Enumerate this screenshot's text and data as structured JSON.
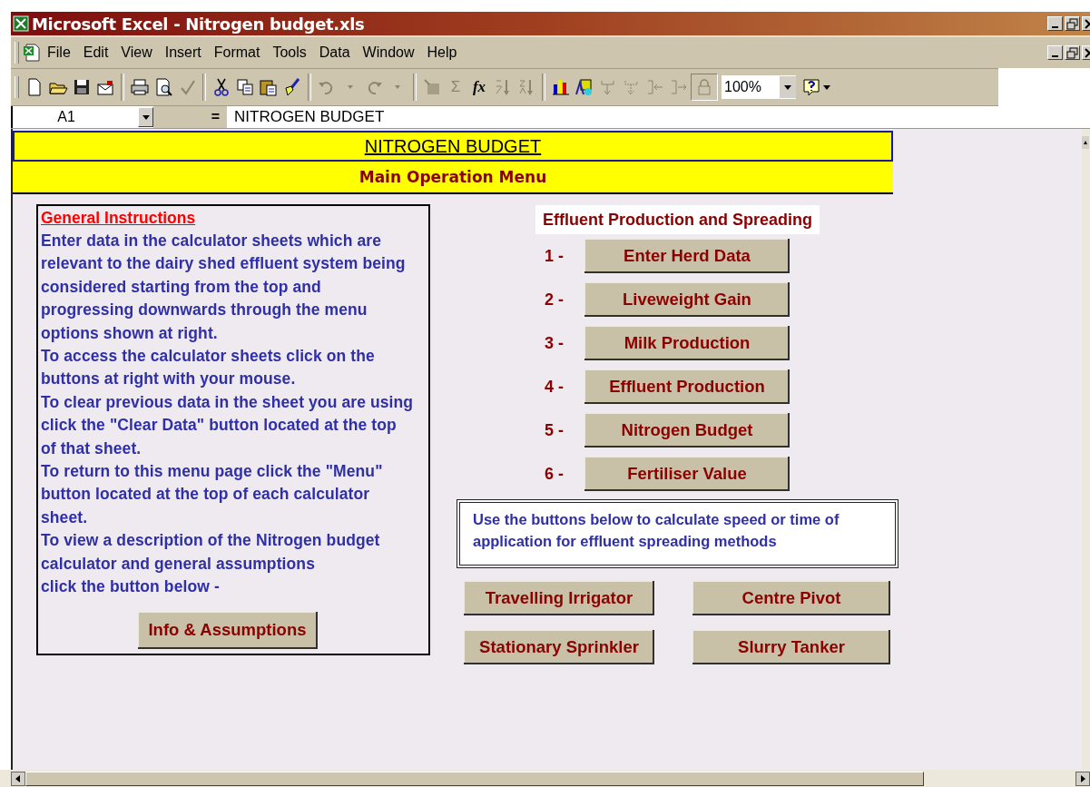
{
  "window": {
    "title": "Microsoft Excel - Nitrogen budget.xls"
  },
  "menu": [
    "File",
    "Edit",
    "View",
    "Insert",
    "Format",
    "Tools",
    "Data",
    "Window",
    "Help"
  ],
  "toolbar": {
    "autosum_glyph": "Σ",
    "function_glyph": "fx",
    "zoom": "100%"
  },
  "formula_bar": {
    "name_box": "A1",
    "equals": "=",
    "formula": "NITROGEN BUDGET"
  },
  "sheet": {
    "title": "NITROGEN BUDGET",
    "subtitle": "Main Operation Menu",
    "instructions": {
      "heading": "General Instructions",
      "paragraphs": [
        "Enter data in the calculator sheets which are relevant to the dairy shed effluent system being considered starting from the top and progressing downwards through the menu options shown at right.",
        "To access the calculator sheets click on the buttons at right with your mouse.",
        "To clear previous data in the sheet you are using click the \"Clear Data\" button located at the top of that sheet.",
        "To return to this menu page click the \"Menu\" button located at the top of each calculator sheet.",
        "To view a description of the Nitrogen budget calculator and general assumptions",
        "click the button below -"
      ],
      "button": "Info & Assumptions"
    },
    "section_title": "Effluent Production and Spreading",
    "steps": [
      {
        "number": "1 -",
        "label": "Enter Herd Data"
      },
      {
        "number": "2 -",
        "label": "Liveweight Gain"
      },
      {
        "number": "3 -",
        "label": "Milk Production"
      },
      {
        "number": "4 -",
        "label": "Effluent Production"
      },
      {
        "number": "5 -",
        "label": "Nitrogen Budget"
      },
      {
        "number": "6 -",
        "label": "Fertiliser Value"
      }
    ],
    "note": "Use the buttons below to calculate speed or time of application for effluent spreading methods",
    "methods": [
      "Travelling Irrigator",
      "Centre Pivot",
      "Stationary Sprinkler",
      "Slurry Tanker"
    ]
  }
}
